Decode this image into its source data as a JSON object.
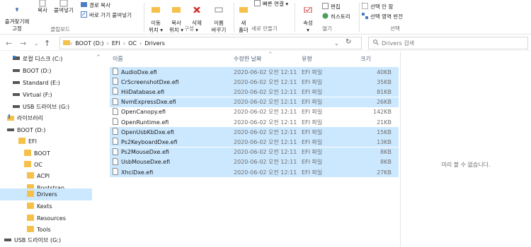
{
  "ribbon": {
    "pin_label": "즐겨찾기에\n고정",
    "copy_label": "복사",
    "paste_label": "붙여넣기",
    "copy_path_label": "경로 복사",
    "paste_shortcut_label": "바로 가기 붙여넣기",
    "clipboard_group": "클립보드",
    "move_label": "이동\n위치 ▾",
    "copyto_label": "복사\n위치 ▾",
    "delete_label": "삭제\n▾",
    "rename_label": "이름\n바꾸기",
    "organize_group": "구성",
    "new_folder_label": "새\n폴더",
    "quick_access_label": "빠른 연결 ▾",
    "new_group": "새로 만들기",
    "properties_label": "속성\n▾",
    "edit_label": "편집",
    "history_label": "히스토리",
    "open_group": "열기",
    "select_none_label": "선택 안 함",
    "invert_selection_label": "선택 영역 반전",
    "select_group": "선택"
  },
  "address": {
    "crumbs": [
      "BOOT (D:)",
      "EFI",
      "OC",
      "Drivers"
    ],
    "search_placeholder": "Drivers 검색"
  },
  "nav_tree": [
    {
      "label": "로컬 디스크 (C:)",
      "icon": "drive-icon"
    },
    {
      "label": "BOOT (D:)",
      "icon": "drive-icon"
    },
    {
      "label": "Standard (E:)",
      "icon": "drive-icon"
    },
    {
      "label": "Virtual (F:)",
      "icon": "drive-icon"
    },
    {
      "label": "USB 드라이브 (G:)",
      "icon": "drive-icon"
    },
    {
      "label": "라이브러리",
      "icon": "library-icon"
    },
    {
      "label": "BOOT (D:)",
      "icon": "drive-icon"
    },
    {
      "label": "EFI",
      "icon": "folder-icon"
    },
    {
      "label": "BOOT",
      "icon": "folder-icon"
    },
    {
      "label": "OC",
      "icon": "folder-icon"
    },
    {
      "label": "ACPI",
      "icon": "folder-icon"
    },
    {
      "label": "Bootstrap",
      "icon": "folder-icon"
    },
    {
      "label": "Drivers",
      "icon": "folder-icon"
    },
    {
      "label": "Kexts",
      "icon": "folder-icon"
    },
    {
      "label": "Resources",
      "icon": "folder-icon"
    },
    {
      "label": "Tools",
      "icon": "folder-icon"
    },
    {
      "label": "USB 드라이브 (G:)",
      "icon": "drive-icon"
    }
  ],
  "columns": {
    "name": "이름",
    "date": "수정한 날짜",
    "type": "유형",
    "size": "크기"
  },
  "files": [
    {
      "name": "AudioDxe.efi",
      "date": "2020-06-02 오전 12:11",
      "type": "EFI 파일",
      "size": "40KB",
      "selected": true
    },
    {
      "name": "CrScreenshotDxe.efi",
      "date": "2020-06-02 오전 12:11",
      "type": "EFI 파일",
      "size": "35KB",
      "selected": true
    },
    {
      "name": "HiiDatabase.efi",
      "date": "2020-06-02 오전 12:11",
      "type": "EFI 파일",
      "size": "81KB",
      "selected": true
    },
    {
      "name": "NvmExpressDxe.efi",
      "date": "2020-06-02 오전 12:11",
      "type": "EFI 파일",
      "size": "26KB",
      "selected": true
    },
    {
      "name": "OpenCanopy.efi",
      "date": "2020-06-02 오전 12:11",
      "type": "EFI 파일",
      "size": "142KB",
      "selected": false
    },
    {
      "name": "OpenRuntime.efi",
      "date": "2020-06-02 오전 12:11",
      "type": "EFI 파일",
      "size": "21KB",
      "selected": false
    },
    {
      "name": "OpenUsbKbDxe.efi",
      "date": "2020-06-02 오전 12:11",
      "type": "EFI 파일",
      "size": "15KB",
      "selected": true
    },
    {
      "name": "Ps2KeyboardDxe.efi",
      "date": "2020-06-02 오전 12:11",
      "type": "EFI 파일",
      "size": "13KB",
      "selected": true
    },
    {
      "name": "Ps2MouseDxe.efi",
      "date": "2020-06-02 오전 12:11",
      "type": "EFI 파일",
      "size": "8KB",
      "selected": true
    },
    {
      "name": "UsbMouseDxe.efi",
      "date": "2020-06-02 오전 12:11",
      "type": "EFI 파일",
      "size": "8KB",
      "selected": true
    },
    {
      "name": "XhciDxe.efi",
      "date": "2020-06-02 오전 12:11",
      "type": "EFI 파일",
      "size": "27KB",
      "selected": true
    }
  ],
  "preview": {
    "message": "미리 볼 수 없습니다."
  },
  "colors": {
    "selection": "#cce8ff",
    "folder": "#f6c14a",
    "accent": "#0078d7"
  }
}
